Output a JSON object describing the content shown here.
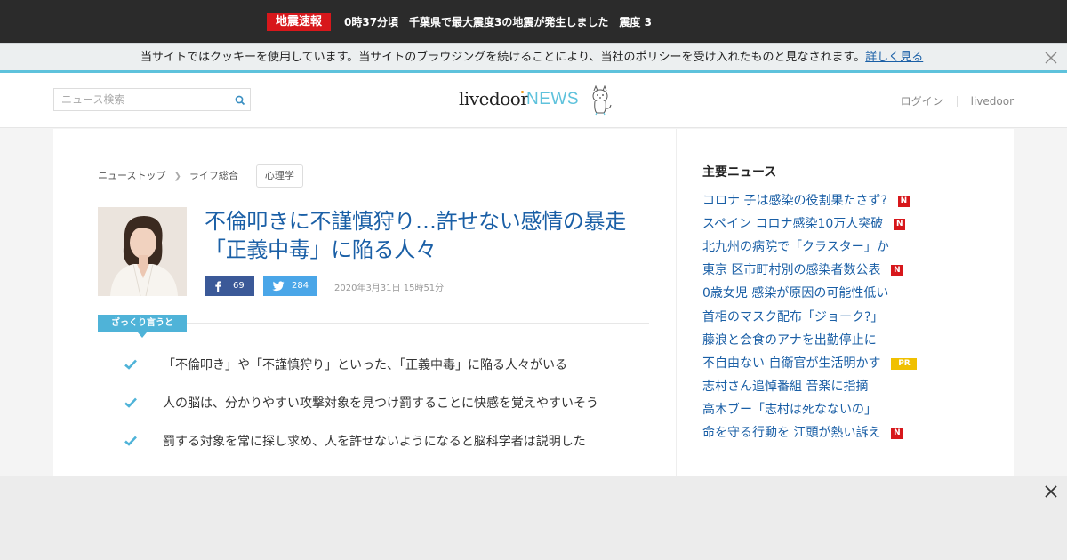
{
  "alert": {
    "badge": "地震速報",
    "text": "0時37分頃　千葉県で最大震度3の地震が発生しました　震度 3"
  },
  "cookie": {
    "text": "当サイトではクッキーを使用しています。当サイトのブラウジングを続けることにより、当社のポリシーを受け入れたものと見なされます。",
    "link": "詳しく見る"
  },
  "header": {
    "search_placeholder": "ニュース検索",
    "logo_main": "livedoor",
    "logo_sub": "NEWS",
    "login": "ログイン",
    "livedoor_link": "livedoor"
  },
  "breadcrumb": {
    "items": [
      "ニューストップ",
      "ライフ総合"
    ],
    "tag": "心理学"
  },
  "article": {
    "headline": "不倫叩きに不謹慎狩り…許せない感情の暴走「正義中毒」に陥る人々",
    "facebook_count": "69",
    "twitter_count": "284",
    "date": "2020年3月31日 15時51分",
    "summary_label": "ざっくり言うと",
    "summary": [
      "「不倫叩き」や「不謹慎狩り」といった、「正義中毒」に陥る人々がいる",
      "人の脳は、分かりやすい攻撃対象を見つけ罰することに快感を覚えやすいそう",
      "罰する対象を常に探し求め、人を許せないようになると脳科学者は説明した"
    ]
  },
  "sidebar": {
    "title": "主要ニュース",
    "items": [
      {
        "text": "コロナ 子は感染の役割果たさず?",
        "badge": "N"
      },
      {
        "text": "スペイン コロナ感染10万人突破",
        "badge": "N"
      },
      {
        "text": "北九州の病院で「クラスター」か",
        "badge": ""
      },
      {
        "text": "東京 区市町村別の感染者数公表",
        "badge": "N"
      },
      {
        "text": "0歳女児 感染が原因の可能性低い",
        "badge": ""
      },
      {
        "text": "首相のマスク配布「ジョーク?」",
        "badge": ""
      },
      {
        "text": "藤浪と会食のアナを出勤停止に",
        "badge": ""
      },
      {
        "text": "不自由ない 自衛官が生活明かす",
        "badge": "PR"
      },
      {
        "text": "志村さん追悼番組 音楽に指摘",
        "badge": ""
      },
      {
        "text": "高木ブー「志村は死なないの」",
        "badge": ""
      },
      {
        "text": "命を守る行動を 江頭が熱い訴え",
        "badge": "N"
      }
    ]
  },
  "colors": {
    "accent": "#5ec2dc",
    "link": "#1a5fa6",
    "alert_red": "#d7171b",
    "facebook": "#3b5998",
    "twitter": "#4aa6e8"
  }
}
